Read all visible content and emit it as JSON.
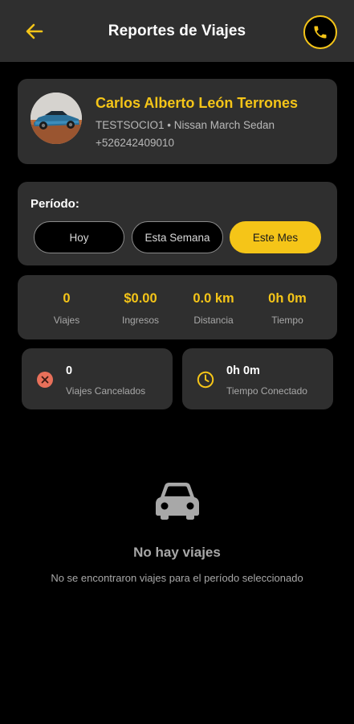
{
  "header": {
    "title": "Reportes de Viajes",
    "back_icon": "arrow-left-icon",
    "call_icon": "phone-icon",
    "accent_color": "#f5c518"
  },
  "driver": {
    "name": "Carlos Alberto León Terrones",
    "vehicle": "TESTSOCIO1 • Nissan March Sedan",
    "phone": "+526242409010",
    "avatar": "blue-sports-car-photo"
  },
  "period": {
    "label": "Período:",
    "options": [
      {
        "label": "Hoy",
        "selected": false
      },
      {
        "label": "Esta Semana",
        "selected": false
      },
      {
        "label": "Este Mes",
        "selected": true
      }
    ]
  },
  "stats": [
    {
      "value": "0",
      "label": "Viajes"
    },
    {
      "value": "$0.00",
      "label": "Ingresos"
    },
    {
      "value": "0.0 km",
      "label": "Distancia"
    },
    {
      "value": "0h 0m",
      "label": "Tiempo"
    }
  ],
  "cancelled": {
    "value": "0",
    "label": "Viajes Cancelados",
    "icon": "cancel-circle-icon",
    "color": "#e8705a"
  },
  "connected": {
    "value": "0h 0m",
    "label": "Tiempo Conectado",
    "icon": "clock-icon",
    "color": "#f5c518"
  },
  "empty_state": {
    "icon": "car-icon",
    "title": "No hay viajes",
    "subtitle": "No se encontraron viajes para el período seleccionado"
  }
}
